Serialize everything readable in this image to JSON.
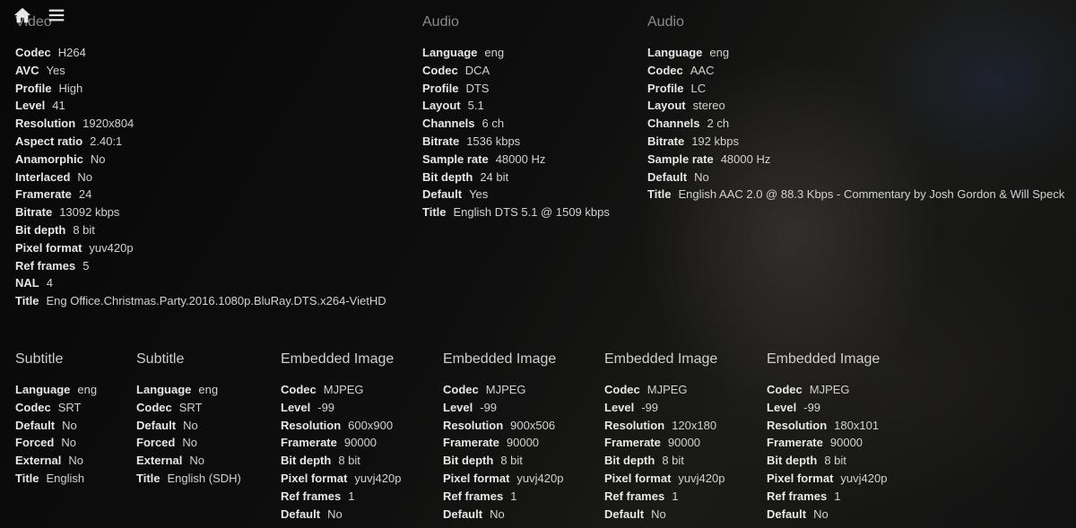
{
  "nav": {
    "home_icon": "home-icon",
    "menu_icon": "menu-icon"
  },
  "sections": [
    {
      "id": "video",
      "title": "Video",
      "rows": [
        {
          "k": "Codec",
          "v": "H264"
        },
        {
          "k": "AVC",
          "v": "Yes"
        },
        {
          "k": "Profile",
          "v": "High"
        },
        {
          "k": "Level",
          "v": "41"
        },
        {
          "k": "Resolution",
          "v": "1920x804"
        },
        {
          "k": "Aspect ratio",
          "v": "2.40:1"
        },
        {
          "k": "Anamorphic",
          "v": "No"
        },
        {
          "k": "Interlaced",
          "v": "No"
        },
        {
          "k": "Framerate",
          "v": "24"
        },
        {
          "k": "Bitrate",
          "v": "13092 kbps"
        },
        {
          "k": "Bit depth",
          "v": "8 bit"
        },
        {
          "k": "Pixel format",
          "v": "yuv420p"
        },
        {
          "k": "Ref frames",
          "v": "5"
        },
        {
          "k": "NAL",
          "v": "4"
        },
        {
          "k": "Title",
          "v": "Eng Office.Christmas.Party.2016.1080p.BluRay.DTS.x264-VietHD"
        }
      ]
    },
    {
      "id": "audio-1",
      "title": "Audio",
      "rows": [
        {
          "k": "Language",
          "v": "eng"
        },
        {
          "k": "Codec",
          "v": "DCA"
        },
        {
          "k": "Profile",
          "v": "DTS"
        },
        {
          "k": "Layout",
          "v": "5.1"
        },
        {
          "k": "Channels",
          "v": "6 ch"
        },
        {
          "k": "Bitrate",
          "v": "1536 kbps"
        },
        {
          "k": "Sample rate",
          "v": "48000 Hz"
        },
        {
          "k": "Bit depth",
          "v": "24 bit"
        },
        {
          "k": "Default",
          "v": "Yes"
        },
        {
          "k": "Title",
          "v": "English DTS 5.1 @ 1509 kbps"
        }
      ]
    },
    {
      "id": "audio-2",
      "title": "Audio",
      "rows": [
        {
          "k": "Language",
          "v": "eng"
        },
        {
          "k": "Codec",
          "v": "AAC"
        },
        {
          "k": "Profile",
          "v": "LC"
        },
        {
          "k": "Layout",
          "v": "stereo"
        },
        {
          "k": "Channels",
          "v": "2 ch"
        },
        {
          "k": "Bitrate",
          "v": "192 kbps"
        },
        {
          "k": "Sample rate",
          "v": "48000 Hz"
        },
        {
          "k": "Default",
          "v": "No"
        },
        {
          "k": "Title",
          "v": "English AAC 2.0 @ 88.3 Kbps - Commentary by Josh Gordon & Will Speck"
        }
      ]
    },
    {
      "id": "subtitle-1",
      "title": "Subtitle",
      "rows": [
        {
          "k": "Language",
          "v": "eng"
        },
        {
          "k": "Codec",
          "v": "SRT"
        },
        {
          "k": "Default",
          "v": "No"
        },
        {
          "k": "Forced",
          "v": "No"
        },
        {
          "k": "External",
          "v": "No"
        },
        {
          "k": "Title",
          "v": "English"
        }
      ]
    },
    {
      "id": "subtitle-2",
      "title": "Subtitle",
      "rows": [
        {
          "k": "Language",
          "v": "eng"
        },
        {
          "k": "Codec",
          "v": "SRT"
        },
        {
          "k": "Default",
          "v": "No"
        },
        {
          "k": "Forced",
          "v": "No"
        },
        {
          "k": "External",
          "v": "No"
        },
        {
          "k": "Title",
          "v": "English (SDH)"
        }
      ]
    },
    {
      "id": "embedded-image-1",
      "title": "Embedded Image",
      "rows": [
        {
          "k": "Codec",
          "v": "MJPEG"
        },
        {
          "k": "Level",
          "v": "-99"
        },
        {
          "k": "Resolution",
          "v": "600x900"
        },
        {
          "k": "Framerate",
          "v": "90000"
        },
        {
          "k": "Bit depth",
          "v": "8 bit"
        },
        {
          "k": "Pixel format",
          "v": "yuvj420p"
        },
        {
          "k": "Ref frames",
          "v": "1"
        },
        {
          "k": "Default",
          "v": "No"
        }
      ]
    },
    {
      "id": "embedded-image-2",
      "title": "Embedded Image",
      "rows": [
        {
          "k": "Codec",
          "v": "MJPEG"
        },
        {
          "k": "Level",
          "v": "-99"
        },
        {
          "k": "Resolution",
          "v": "900x506"
        },
        {
          "k": "Framerate",
          "v": "90000"
        },
        {
          "k": "Bit depth",
          "v": "8 bit"
        },
        {
          "k": "Pixel format",
          "v": "yuvj420p"
        },
        {
          "k": "Ref frames",
          "v": "1"
        },
        {
          "k": "Default",
          "v": "No"
        }
      ]
    },
    {
      "id": "embedded-image-3",
      "title": "Embedded Image",
      "rows": [
        {
          "k": "Codec",
          "v": "MJPEG"
        },
        {
          "k": "Level",
          "v": "-99"
        },
        {
          "k": "Resolution",
          "v": "120x180"
        },
        {
          "k": "Framerate",
          "v": "90000"
        },
        {
          "k": "Bit depth",
          "v": "8 bit"
        },
        {
          "k": "Pixel format",
          "v": "yuvj420p"
        },
        {
          "k": "Ref frames",
          "v": "1"
        },
        {
          "k": "Default",
          "v": "No"
        }
      ]
    },
    {
      "id": "embedded-image-4",
      "title": "Embedded Image",
      "rows": [
        {
          "k": "Codec",
          "v": "MJPEG"
        },
        {
          "k": "Level",
          "v": "-99"
        },
        {
          "k": "Resolution",
          "v": "180x101"
        },
        {
          "k": "Framerate",
          "v": "90000"
        },
        {
          "k": "Bit depth",
          "v": "8 bit"
        },
        {
          "k": "Pixel format",
          "v": "yuvj420p"
        },
        {
          "k": "Ref frames",
          "v": "1"
        },
        {
          "k": "Default",
          "v": "No"
        }
      ]
    }
  ]
}
